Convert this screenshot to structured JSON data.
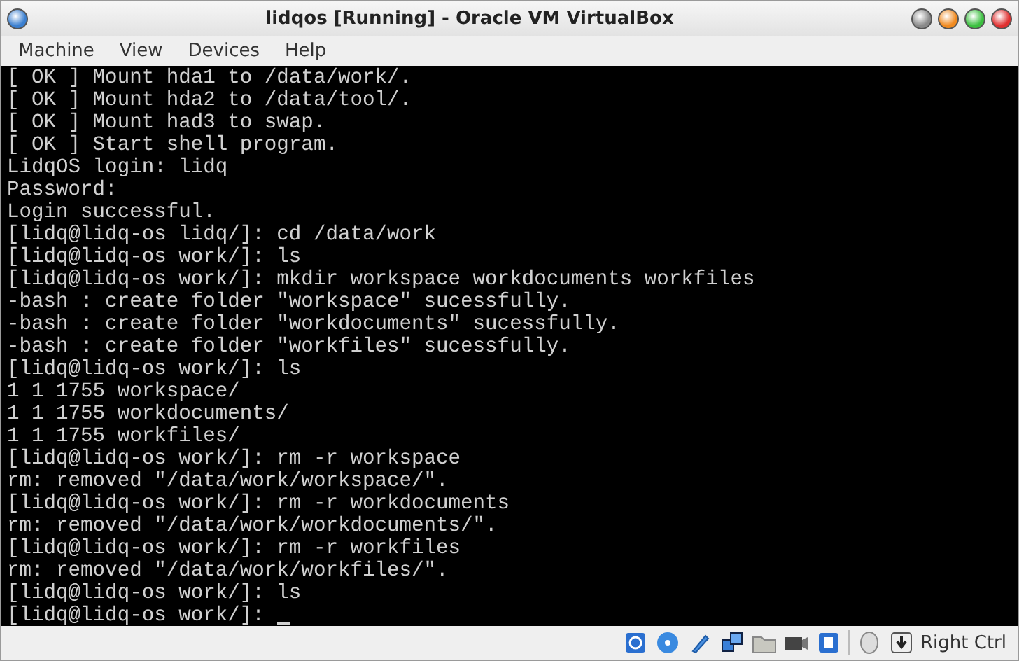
{
  "window": {
    "title": "lidqos [Running] - Oracle VM VirtualBox"
  },
  "menu": [
    "Machine",
    "View",
    "Devices",
    "Help"
  ],
  "terminal": {
    "lines": [
      "[ OK ] Mount hda1 to /data/work/.",
      "[ OK ] Mount hda2 to /data/tool/.",
      "[ OK ] Mount had3 to swap.",
      "[ OK ] Start shell program.",
      "LidqOS login: lidq",
      "Password:",
      "Login successful.",
      "[lidq@lidq-os lidq/]: cd /data/work",
      "[lidq@lidq-os work/]: ls",
      "[lidq@lidq-os work/]: mkdir workspace workdocuments workfiles",
      "-bash : create folder \"workspace\" sucessfully.",
      "-bash : create folder \"workdocuments\" sucessfully.",
      "-bash : create folder \"workfiles\" sucessfully.",
      "[lidq@lidq-os work/]: ls",
      "1 1 1755 workspace/",
      "1 1 1755 workdocuments/",
      "1 1 1755 workfiles/",
      "[lidq@lidq-os work/]: rm -r workspace",
      "rm: removed \"/data/work/workspace/\".",
      "[lidq@lidq-os work/]: rm -r workdocuments",
      "rm: removed \"/data/work/workdocuments/\".",
      "[lidq@lidq-os work/]: rm -r workfiles",
      "rm: removed \"/data/work/workfiles/\".",
      "[lidq@lidq-os work/]: ls",
      "[lidq@lidq-os work/]:"
    ]
  },
  "status_bar": {
    "host_key": "Right Ctrl"
  }
}
